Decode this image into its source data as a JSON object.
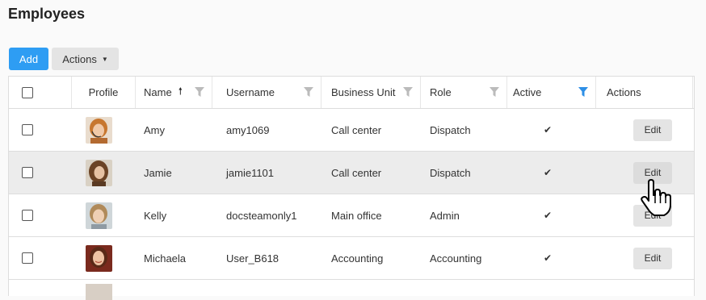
{
  "page": {
    "title": "Employees"
  },
  "toolbar": {
    "add_label": "Add",
    "actions_label": "Actions"
  },
  "table": {
    "headers": {
      "profile": "Profile",
      "name": "Name",
      "username": "Username",
      "business_unit": "Business Unit",
      "role": "Role",
      "active": "Active",
      "actions": "Actions"
    },
    "sort": {
      "column": "name",
      "direction": "ascending"
    },
    "active_filter_color": "#2e8fe6",
    "rows": [
      {
        "name": "Amy",
        "username": "amy1069",
        "business_unit": "Call center",
        "role": "Dispatch",
        "active": true,
        "action_label": "Edit",
        "avatar": "avatar-amy"
      },
      {
        "name": "Jamie",
        "username": "jamie1101",
        "business_unit": "Call center",
        "role": "Dispatch",
        "active": true,
        "action_label": "Edit",
        "avatar": "avatar-jamie"
      },
      {
        "name": "Kelly",
        "username": "docsteamonly1",
        "business_unit": "Main office",
        "role": "Admin",
        "active": true,
        "action_label": "Edit",
        "avatar": "avatar-kelly"
      },
      {
        "name": "Michaela",
        "username": "User_B618",
        "business_unit": "Accounting",
        "role": "Accounting",
        "active": true,
        "action_label": "Edit",
        "avatar": "avatar-michaela"
      }
    ]
  }
}
